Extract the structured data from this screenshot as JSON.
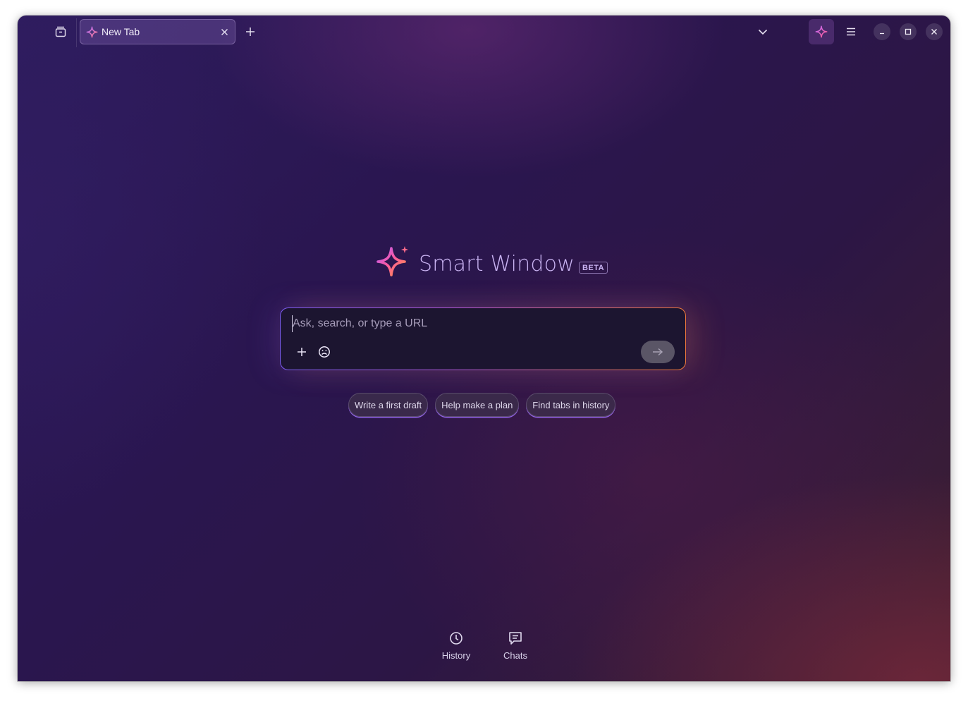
{
  "colors": {
    "accent": "#c9b3f2",
    "input_background": "#1c1530",
    "gradient_start": "#7b5cf0",
    "gradient_end": "#f07a3a"
  },
  "toolbar": {
    "tab_list_icon": "tab-list-icon",
    "new_tab_icon": "plus-icon",
    "overflow_icon": "chevron-down-icon",
    "smart_icon": "sparkle-icon",
    "menu_icon": "hamburger-menu-icon"
  },
  "tabs": [
    {
      "title": "New Tab",
      "favicon": "sparkle-icon",
      "close_icon": "close-icon"
    }
  ],
  "window_controls": {
    "minimize_icon": "minimize-icon",
    "maximize_icon": "maximize-icon",
    "close_icon": "close-icon"
  },
  "brand": {
    "title": "Smart Window",
    "badge": "BETA"
  },
  "search": {
    "placeholder": "Ask, search, or type a URL",
    "value": "",
    "attach_icon": "plus-icon",
    "persona_icon": "smiley-face-icon",
    "submit_icon": "arrow-right-icon"
  },
  "suggestions": [
    "Write a first draft",
    "Help make a plan",
    "Find tabs in history"
  ],
  "bottom_nav": {
    "history_label": "History",
    "chats_label": "Chats"
  }
}
